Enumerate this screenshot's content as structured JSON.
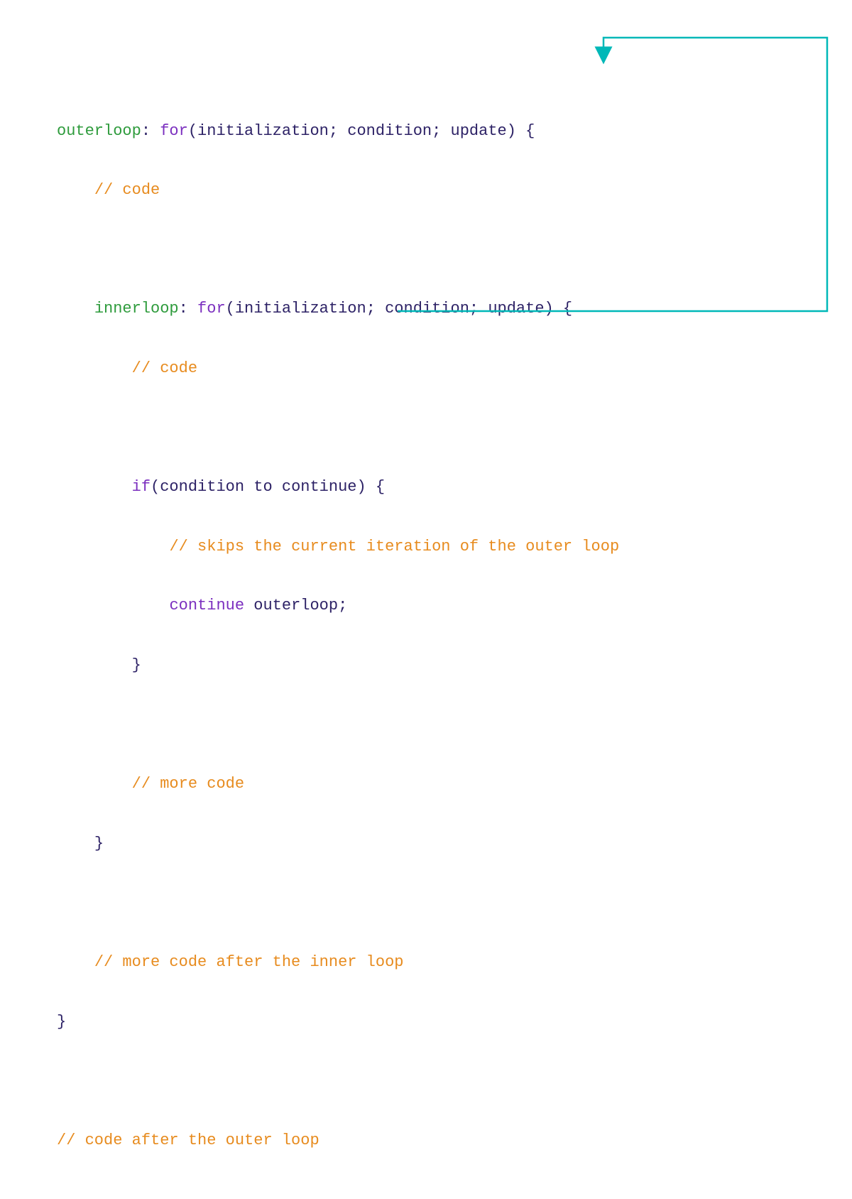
{
  "line1": {
    "label": "outerloop",
    "colon": ": ",
    "keyword": "for",
    "args": "(initialization; condition; update) {"
  },
  "line2": {
    "indent": "    ",
    "comment": "// code"
  },
  "line3": "",
  "line4": {
    "indent": "    ",
    "label": "innerloop",
    "colon": ": ",
    "keyword": "for",
    "args": "(initialization; condition; update) {"
  },
  "line5": {
    "indent": "        ",
    "comment": "// code"
  },
  "line6": "",
  "line7": {
    "indent": "        ",
    "keyword": "if",
    "args": "(condition to continue) {"
  },
  "line8": {
    "indent": "            ",
    "comment": "// skips the current iteration of the outer loop"
  },
  "line9": {
    "indent": "            ",
    "keyword": "continue",
    "space": " ",
    "target": "outerloop;"
  },
  "line10": {
    "indent": "        ",
    "brace": "}"
  },
  "line11": "",
  "line12": {
    "indent": "        ",
    "comment": "// more code"
  },
  "line13": {
    "indent": "    ",
    "brace": "}"
  },
  "line14": "",
  "line15": {
    "indent": "    ",
    "comment": "// more code after the inner loop"
  },
  "line16": {
    "brace": "}"
  },
  "line17": "",
  "line18": {
    "comment": "// code after the outer loop"
  },
  "arrow": {
    "color": "#00b8b8"
  }
}
